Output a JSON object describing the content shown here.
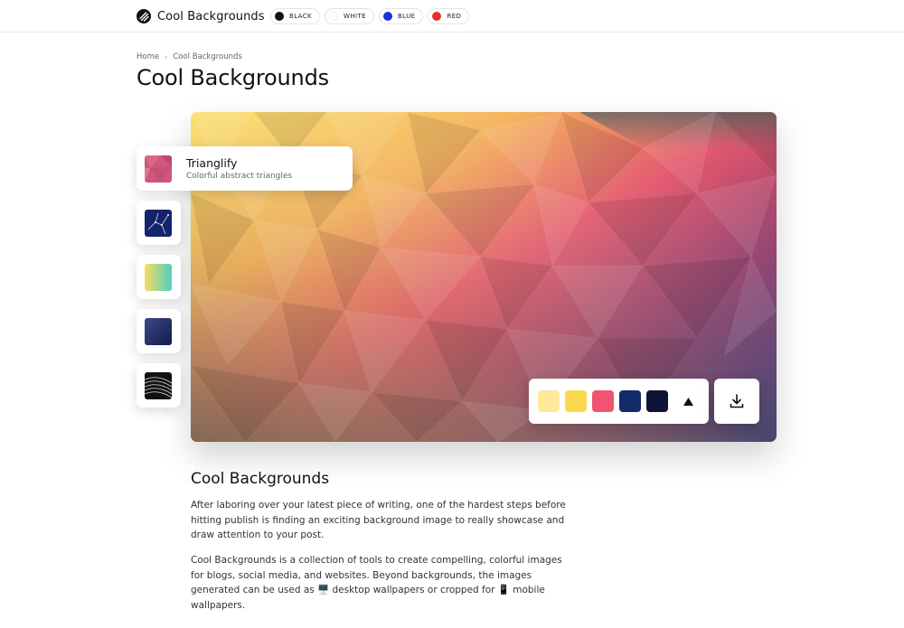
{
  "brand": {
    "name": "Cool Backgrounds",
    "logo_icon": "slashes-logo-icon"
  },
  "color_filters": [
    {
      "label": "BLACK",
      "color": "#111111"
    },
    {
      "label": "WHITE",
      "color": "#ffffff"
    },
    {
      "label": "BLUE",
      "color": "#1b2fd8"
    },
    {
      "label": "RED",
      "color": "#e4312b"
    }
  ],
  "breadcrumb": {
    "home": "Home",
    "separator": "›",
    "current": "Cool Backgrounds"
  },
  "page_title": "Cool Backgrounds",
  "tools": {
    "active": {
      "name": "Trianglify",
      "description": "Colorful abstract triangles"
    },
    "others": [
      {
        "icon": "constellation-thumbnail-icon"
      },
      {
        "icon": "gradient-thumbnail-icon"
      },
      {
        "icon": "dark-gradient-thumbnail-icon"
      },
      {
        "icon": "wave-pattern-thumbnail-icon"
      }
    ]
  },
  "palette": {
    "swatches": [
      "#fde99a",
      "#fbd94e",
      "#ef5470",
      "#132a6b",
      "#0e1438"
    ],
    "shuffle_icon": "triangle-up-icon",
    "download_icon": "download-icon"
  },
  "article": {
    "title": "Cool Backgrounds",
    "paragraph1": "After laboring over your latest piece of writing, one of the hardest steps before hitting publish is finding an exciting background image to really showcase and draw attention to your post.",
    "paragraph2": "Cool Backgrounds is a collection of tools to create compelling, colorful images for blogs, social media, and websites. Beyond backgrounds, the images generated can be used as 🖥️ desktop wallpapers or cropped for 📱 mobile wallpapers."
  }
}
